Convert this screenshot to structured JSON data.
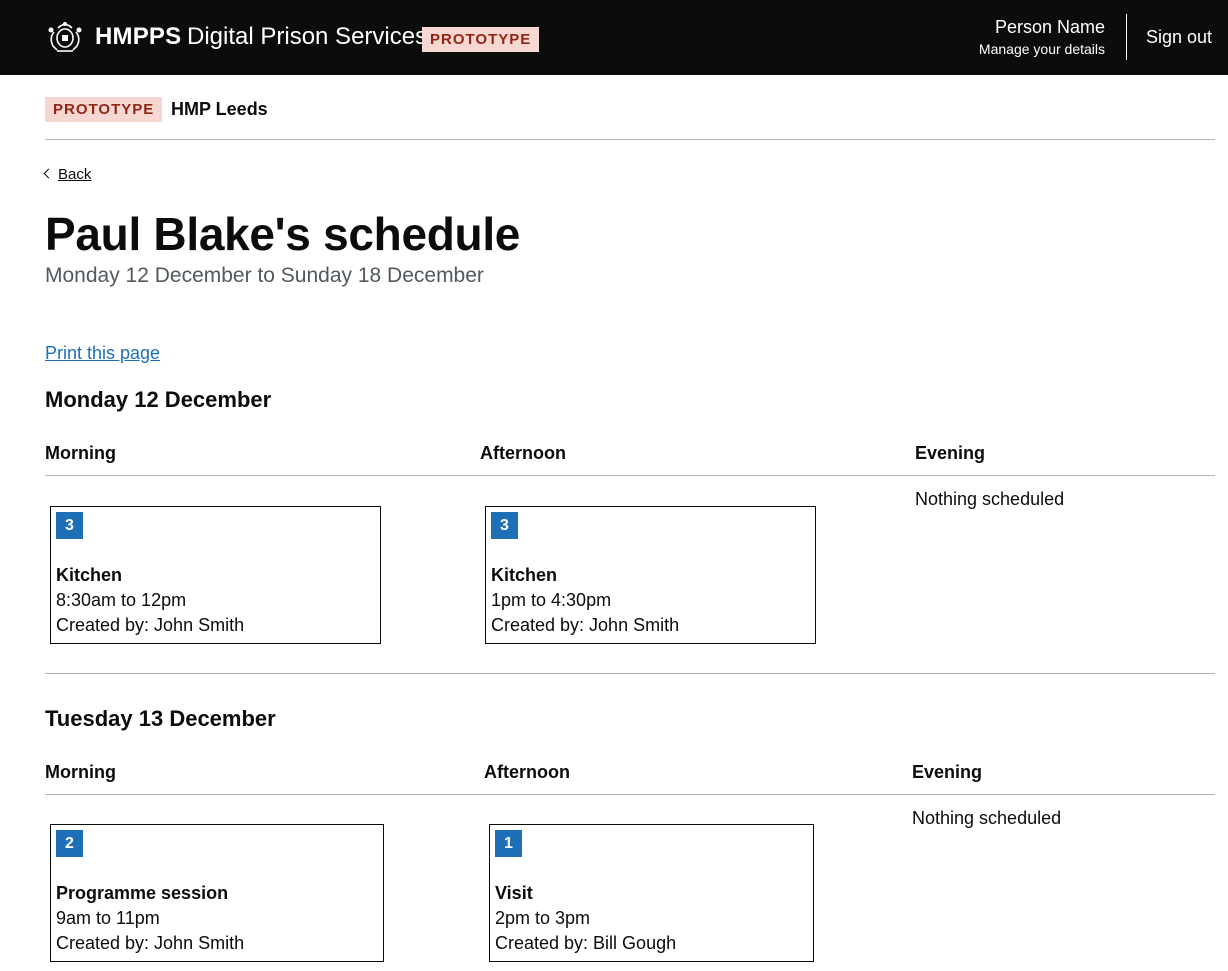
{
  "header": {
    "brand": "HMPPS",
    "service_name": "Digital Prison Services",
    "tag": "PROTOTYPE",
    "user_name": "Person Name",
    "manage_link": "Manage your details",
    "sign_out": "Sign out",
    "crest_icon": "royal-crest-icon"
  },
  "subheader": {
    "tag": "PROTOTYPE",
    "prison": "HMP Leeds"
  },
  "back": {
    "label": "Back"
  },
  "page": {
    "title": "Paul Blake's schedule",
    "caption": "Monday 12 December to Sunday 18 December",
    "print_link": "Print this page"
  },
  "columns": {
    "morning": "Morning",
    "afternoon": "Afternoon",
    "evening": "Evening"
  },
  "days": [
    {
      "heading": "Monday 12 December",
      "morning": {
        "count": "3",
        "title": "Kitchen",
        "time": "8:30am to 12pm",
        "created_by": "Created by: John Smith"
      },
      "afternoon": {
        "count": "3",
        "title": "Kitchen",
        "time": "1pm to 4:30pm",
        "created_by": "Created by: John Smith"
      },
      "evening": {
        "empty": "Nothing scheduled"
      }
    },
    {
      "heading": "Tuesday 13 December",
      "morning": {
        "count": "2",
        "title": "Programme session",
        "time": "9am to 11pm",
        "created_by": "Created by: John Smith"
      },
      "afternoon": {
        "count": "1",
        "title": "Visit",
        "time": "2pm to 3pm",
        "created_by": "Created by: Bill Gough"
      },
      "evening": {
        "empty": "Nothing scheduled"
      }
    }
  ],
  "colors": {
    "header_bg": "#0b0c0c",
    "tag_bg": "#f6d7d2",
    "tag_text": "#942514",
    "link": "#1d70b8",
    "badge": "#1d70b8",
    "rule": "#b1b4b6"
  }
}
